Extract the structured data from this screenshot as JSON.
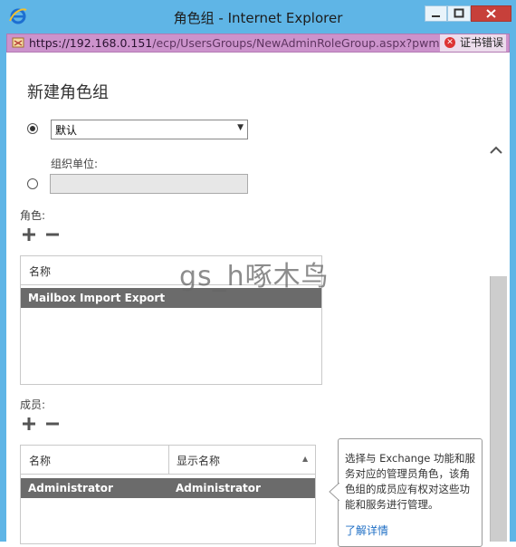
{
  "window": {
    "title": "角色组 - Internet Explorer"
  },
  "address_bar": {
    "url_host": "https://192.168.0.151",
    "url_path": "/ecp/UsersGroups/NewAdminRoleGroup.aspx?pwmcid=",
    "cert_error": "证书错误"
  },
  "page": {
    "title": "新建角色组"
  },
  "scope": {
    "dropdown_value": "默认",
    "ou_label": "组织单位:",
    "ou_value": ""
  },
  "roles": {
    "label": "角色:",
    "column_header": "名称",
    "rows": [
      "Mailbox Import Export"
    ]
  },
  "members": {
    "label": "成员:",
    "columns": [
      "名称",
      "显示名称"
    ],
    "rows": [
      {
        "name": "Administrator",
        "display_name": "Administrator"
      }
    ]
  },
  "tooltip": {
    "text": "选择与 Exchange 功能和服务对应的管理员角色，该角色组的成员应有权对这些功能和服务进行管理。",
    "link": "了解详情"
  },
  "watermark": "gs_h啄木鸟",
  "colors": {
    "titlebar": "#5fb5e6",
    "address_bar_error": "#cc93cc",
    "selected_row": "#6b6b6b",
    "link": "#1f6fc5"
  },
  "icons": [
    "ie-logo-icon",
    "minimize-icon",
    "maximize-icon",
    "close-icon",
    "certificate-error-icon",
    "add-icon",
    "remove-icon",
    "chevron-up-icon",
    "sort-ascending-icon"
  ]
}
